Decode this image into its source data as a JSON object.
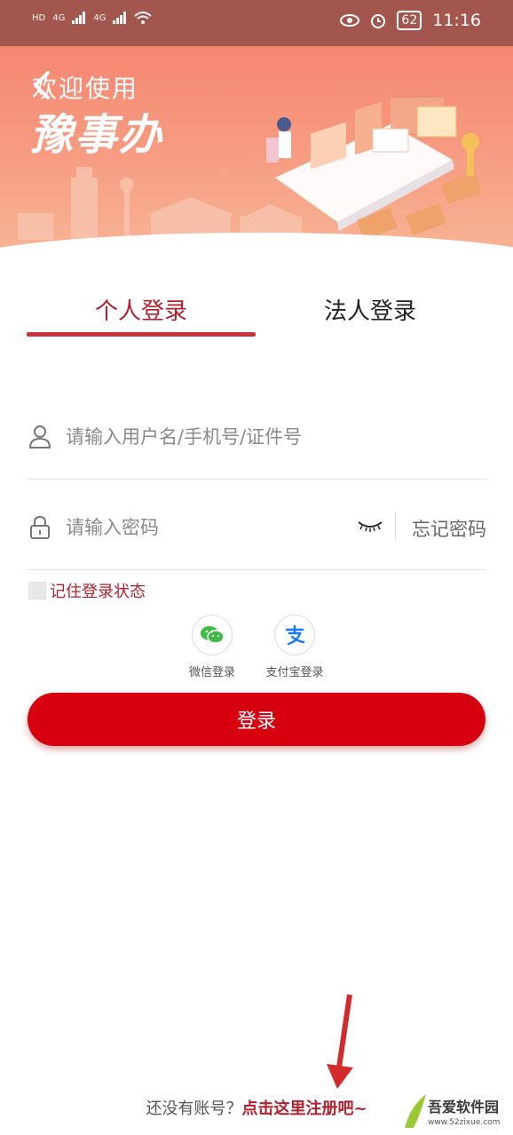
{
  "status_bar": {
    "left_labels": [
      "HD",
      "4G",
      "4G"
    ],
    "battery": "62",
    "time": "11:16"
  },
  "hero": {
    "welcome": "欢迎使用",
    "brand": "豫事办"
  },
  "tabs": [
    {
      "label": "个人登录",
      "active": true
    },
    {
      "label": "法人登录",
      "active": false
    }
  ],
  "form": {
    "username_placeholder": "请输入用户名/手机号/证件号",
    "username_value": "",
    "password_placeholder": "请输入密码",
    "password_value": "",
    "forgot_label": "忘记密码",
    "remember_label": "记住登录状态",
    "remember_checked": false
  },
  "social": [
    {
      "label": "微信登录",
      "icon": "wechat-icon",
      "color": "#3dbb44"
    },
    {
      "label": "支付宝登录",
      "icon": "alipay-icon",
      "color": "#1677ff"
    }
  ],
  "login_button": "登录",
  "register": {
    "prompt": "还没有账号？",
    "link": "点击这里注册吧~"
  },
  "watermark": {
    "line1": "吾爱软件园",
    "line2": "www.52zixue.com"
  },
  "colors": {
    "accent": "#b41f2d",
    "button": "#d7000f",
    "hero_top": "#f47d6b"
  }
}
